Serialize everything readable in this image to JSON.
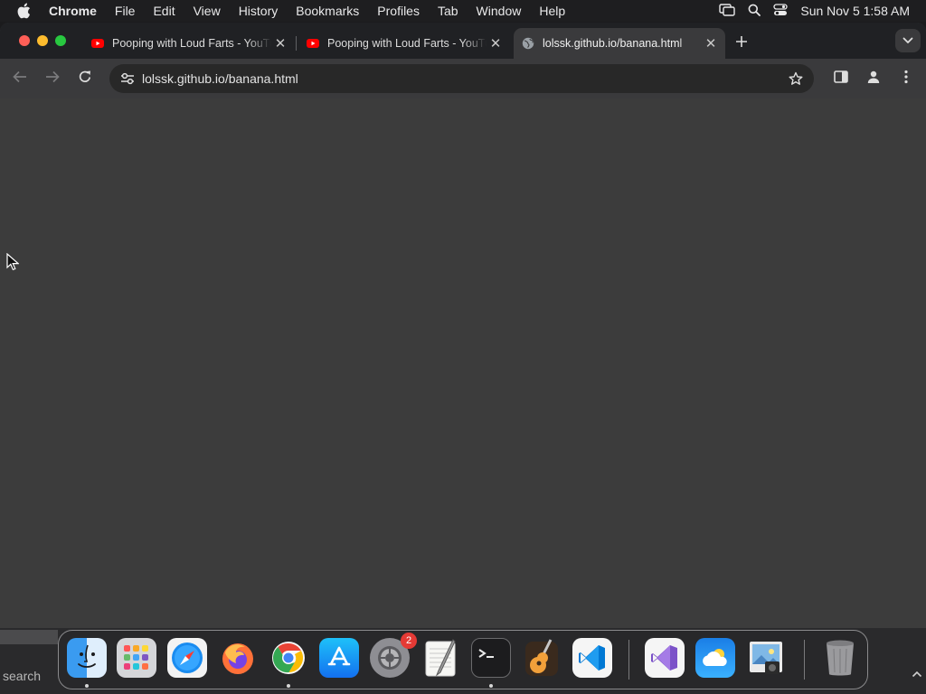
{
  "menubar": {
    "app_name": "Chrome",
    "items": [
      "File",
      "Edit",
      "View",
      "History",
      "Bookmarks",
      "Profiles",
      "Tab",
      "Window",
      "Help"
    ],
    "clock": "Sun Nov 5  1:58 AM"
  },
  "tabs": [
    {
      "title": "Pooping with Loud Farts - YouTube",
      "favicon": "youtube-icon",
      "active": false
    },
    {
      "title": "Pooping with Loud Farts - YouTube",
      "favicon": "youtube-icon",
      "active": false
    },
    {
      "title": "lolssk.github.io/banana.html",
      "favicon": "globe-icon",
      "active": true
    }
  ],
  "omnibox": {
    "url": "lolssk.github.io/banana.html"
  },
  "behind_window": {
    "search_text": "search"
  },
  "dock": {
    "apps": [
      {
        "name": "Finder",
        "icon": "finder-icon",
        "running": true
      },
      {
        "name": "Launchpad",
        "icon": "launchpad-icon",
        "running": false
      },
      {
        "name": "Safari",
        "icon": "safari-icon",
        "running": false
      },
      {
        "name": "Firefox",
        "icon": "firefox-icon",
        "running": false
      },
      {
        "name": "Chrome",
        "icon": "chrome-icon",
        "running": true
      },
      {
        "name": "App Store",
        "icon": "app-store-icon",
        "running": false
      },
      {
        "name": "System Settings",
        "icon": "settings-icon",
        "running": false,
        "badge": "2"
      },
      {
        "name": "TextEdit",
        "icon": "textedit-icon",
        "running": false
      },
      {
        "name": "Terminal",
        "icon": "terminal-icon",
        "running": true
      },
      {
        "name": "GarageBand",
        "icon": "garageband-icon",
        "running": false
      },
      {
        "name": "VS Code",
        "icon": "vscode-icon",
        "running": false
      },
      {
        "name": "Visual Studio",
        "icon": "visual-studio-icon",
        "running": false
      },
      {
        "name": "Weather",
        "icon": "weather-icon",
        "running": false
      },
      {
        "name": "Preview",
        "icon": "preview-icon",
        "running": false
      },
      {
        "name": "Trash",
        "icon": "trash-icon",
        "running": false
      }
    ]
  },
  "colors": {
    "content_bg": "#3c3c3c",
    "tabstrip_bg": "#202124",
    "toolbar_bg": "#3a3a3c"
  }
}
